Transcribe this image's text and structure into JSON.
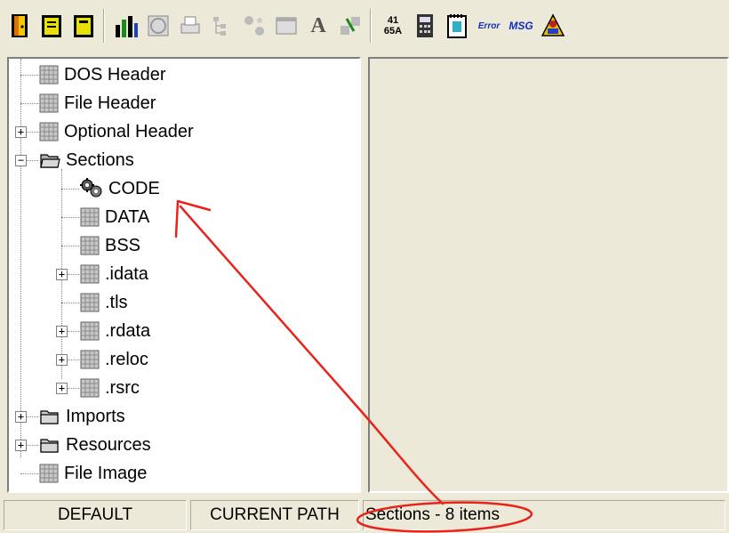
{
  "toolbar": {
    "buttons": [
      {
        "icon": "exit-door-icon"
      },
      {
        "icon": "open-file-icon"
      },
      {
        "icon": "save-file-icon"
      },
      {
        "icon": "bar-chart-icon"
      },
      {
        "icon": "globe-icon"
      },
      {
        "icon": "print-icon"
      },
      {
        "icon": "tree-icon"
      },
      {
        "icon": "dependencies-icon"
      },
      {
        "icon": "window-icon"
      },
      {
        "icon": "font-icon",
        "glyph": "A"
      },
      {
        "icon": "transfer-icon"
      },
      {
        "icon": "hex-convert-icon",
        "glyph_top": "41",
        "glyph_bottom": "65A"
      },
      {
        "icon": "calculator-icon"
      },
      {
        "icon": "notepad-icon"
      },
      {
        "icon": "error-lookup-icon",
        "glyph": "Error"
      },
      {
        "icon": "message-lookup-icon",
        "glyph": "MSG"
      },
      {
        "icon": "help-icon"
      }
    ]
  },
  "tree": {
    "items": [
      {
        "label": "DOS Header"
      },
      {
        "label": "File Header"
      },
      {
        "label": "Optional Header"
      },
      {
        "label": "Sections"
      },
      {
        "label": "CODE"
      },
      {
        "label": "DATA"
      },
      {
        "label": "BSS"
      },
      {
        "label": ".idata"
      },
      {
        "label": ".tls"
      },
      {
        "label": ".rdata"
      },
      {
        "label": ".reloc"
      },
      {
        "label": ".rsrc"
      },
      {
        "label": "Imports"
      },
      {
        "label": "Resources"
      },
      {
        "label": "File Image"
      }
    ]
  },
  "status": {
    "default": "DEFAULT",
    "current_path": "CURRENT PATH",
    "info": "Sections - 8 items"
  },
  "annotation_color": "#e8231a"
}
